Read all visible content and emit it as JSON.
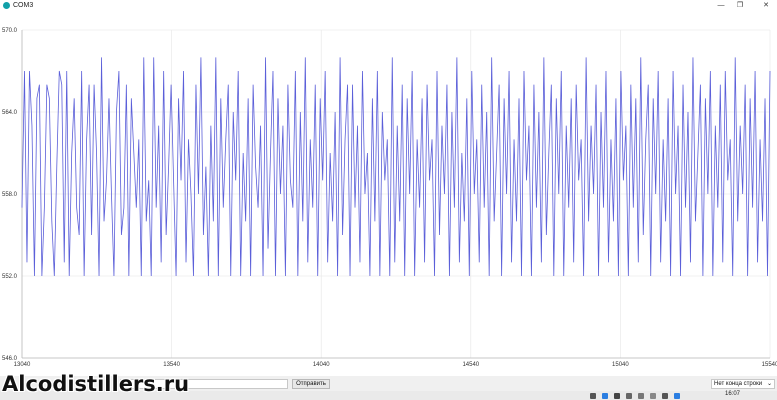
{
  "window": {
    "title": "COM3",
    "minimize_icon": "minimize-icon",
    "maximize_icon": "maximize-icon",
    "close_icon": "close-icon"
  },
  "plotter": {
    "line_color": "#5b5fd9",
    "grid_color": "#e6e6e6",
    "axis_color": "#b9b9b9"
  },
  "chart_data": {
    "type": "line",
    "title": "",
    "xlabel": "",
    "ylabel": "",
    "ylim": [
      546.0,
      570.0
    ],
    "y_ticks": [
      "570.0",
      "564.0",
      "558.0",
      "552.0",
      "546.0"
    ],
    "x_tick_labels": [
      "13040",
      "13540",
      "14040",
      "14540",
      "15040",
      "15540"
    ],
    "xlim": [
      13040,
      15540
    ],
    "grid": true,
    "series": [
      {
        "values": [
          557,
          567,
          553,
          567,
          563,
          552,
          565,
          566,
          552,
          557,
          566,
          565,
          556,
          552,
          560,
          567,
          566,
          553,
          567,
          552,
          561,
          565,
          557,
          555,
          567,
          552,
          562,
          566,
          555,
          566,
          561,
          552,
          568,
          556,
          559,
          565,
          558,
          552,
          564,
          567,
          555,
          557,
          566,
          552,
          565,
          561,
          557,
          562,
          552,
          568,
          556,
          559,
          552,
          568,
          557,
          563,
          553,
          567,
          555,
          560,
          566,
          559,
          552,
          565,
          559,
          567,
          553,
          562,
          558,
          552,
          566,
          558,
          568,
          555,
          560,
          552,
          563,
          556,
          568,
          552,
          565,
          557,
          562,
          566,
          552,
          564,
          559,
          567,
          552,
          561,
          556,
          565,
          552,
          566,
          560,
          557,
          563,
          552,
          568,
          554,
          561,
          567,
          552,
          565,
          558,
          563,
          552,
          566,
          559,
          557,
          567,
          552,
          564,
          556,
          568,
          553,
          562,
          557,
          566,
          552,
          565,
          559,
          567,
          553,
          561,
          556,
          564,
          552,
          568,
          555,
          562,
          566,
          552,
          566,
          557,
          563,
          553,
          567,
          558,
          561,
          552,
          565,
          556,
          567,
          552,
          564,
          559,
          562,
          552,
          568,
          553,
          563,
          556,
          566,
          552,
          565,
          558,
          567,
          552,
          562,
          557,
          565,
          553,
          566,
          559,
          562,
          552,
          567,
          555,
          563,
          558,
          566,
          552,
          564,
          557,
          568,
          553,
          561,
          556,
          565,
          552,
          567,
          558,
          562,
          553,
          566,
          557,
          564,
          552,
          568,
          556,
          561,
          566,
          552,
          565,
          558,
          567,
          553,
          562,
          556,
          565,
          552,
          567,
          559,
          563,
          552,
          566,
          557,
          564,
          553,
          568,
          555,
          561,
          566,
          552,
          565,
          558,
          567,
          552,
          563,
          557,
          565,
          553,
          566,
          559,
          562,
          552,
          568,
          556,
          563,
          558,
          566,
          552,
          564,
          557,
          567,
          553,
          562,
          556,
          565,
          552,
          567,
          559,
          563,
          552,
          566,
          557,
          565,
          553,
          568,
          555,
          562,
          566,
          552,
          565,
          558,
          567,
          553,
          562,
          556,
          565,
          552,
          567,
          558,
          563,
          552,
          566,
          557,
          564,
          553,
          568,
          556,
          561,
          566,
          552,
          565,
          558,
          567,
          552,
          563,
          557,
          566,
          553,
          567,
          559,
          562,
          552,
          568,
          556,
          563,
          558,
          566,
          552,
          565,
          557,
          567,
          553,
          562,
          556,
          565,
          552,
          567
        ]
      }
    ]
  },
  "controls": {
    "send_input_value": "",
    "send_label": "Отправить",
    "line_ending_value": "Нет конца строки"
  },
  "taskbar": {
    "time": "16:07"
  },
  "watermark": {
    "text": "Alcodistillers.ru"
  }
}
